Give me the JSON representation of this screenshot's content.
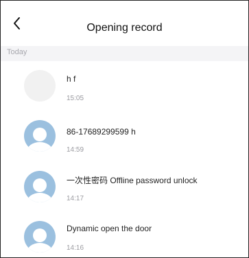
{
  "header": {
    "title": "Opening record",
    "back_icon": "chevron-left-icon"
  },
  "section": {
    "label": "Today"
  },
  "records": [
    {
      "name": "h f",
      "time": "15:05",
      "avatar": "blank"
    },
    {
      "name": "86-17689299599 h",
      "time": "14:59",
      "avatar": "default-user-icon"
    },
    {
      "name": "一次性密码 Offline password unlock",
      "time": "14:17",
      "avatar": "default-user-icon"
    },
    {
      "name": "Dynamic open the door",
      "time": "14:16",
      "avatar": "default-user-icon"
    }
  ],
  "colors": {
    "avatar_bg": "#9bc0df",
    "section_bg": "#f4f4f6",
    "muted_text": "#9a9aa0"
  }
}
